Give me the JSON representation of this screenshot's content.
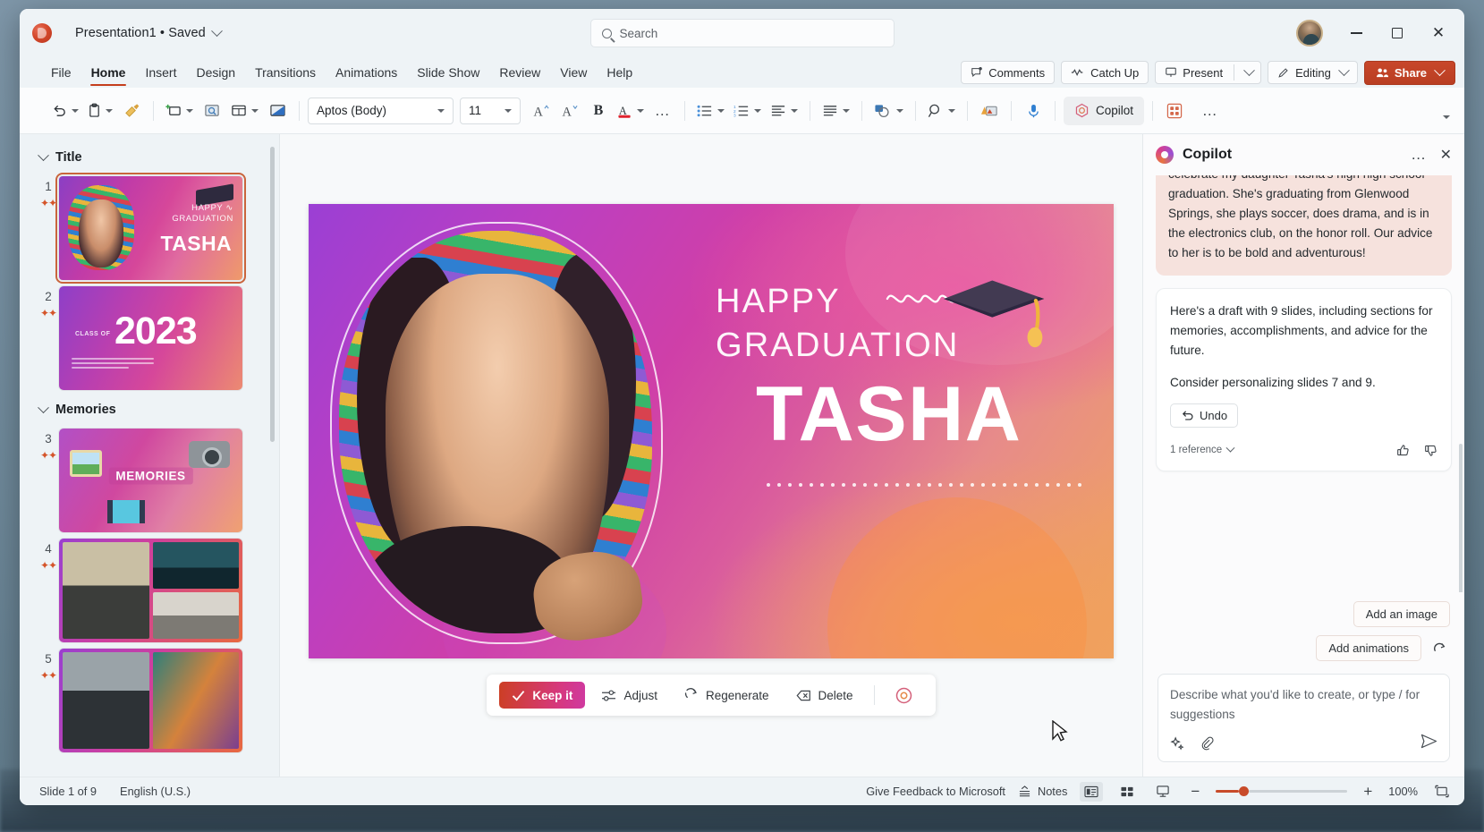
{
  "titlebar": {
    "app_icon": "powerpoint-logo",
    "document_name": "Presentation1 • Saved",
    "search_placeholder": "Search",
    "avatar": "user-avatar",
    "minimize": "–",
    "maximize": "▢",
    "close": "✕"
  },
  "ribbon": {
    "tabs": [
      {
        "label": "File",
        "active": false
      },
      {
        "label": "Home",
        "active": true
      },
      {
        "label": "Insert",
        "active": false
      },
      {
        "label": "Design",
        "active": false
      },
      {
        "label": "Transitions",
        "active": false
      },
      {
        "label": "Animations",
        "active": false
      },
      {
        "label": "Slide Show",
        "active": false
      },
      {
        "label": "Review",
        "active": false
      },
      {
        "label": "View",
        "active": false
      },
      {
        "label": "Help",
        "active": false
      }
    ],
    "actions": {
      "comments": "Comments",
      "catch_up": "Catch Up",
      "present": "Present",
      "editing": "Editing",
      "share": "Share"
    }
  },
  "toolbar": {
    "undo": "undo-icon",
    "paste": "paste-icon",
    "format_painter": "format-painter-icon",
    "new_slide": "new-slide-icon",
    "layout_search": "slide-preview-icon",
    "layout": "layout-icon",
    "picture": "picture-icon",
    "font_name": "Aptos (Body)",
    "font_size": "11",
    "grow_font": "A",
    "shrink_font": "A",
    "bold": "B",
    "font_color": "A",
    "more_font": "…",
    "bullets": "bullets-icon",
    "numbering": "numbering-icon",
    "align": "align-icon",
    "paragraph_align": "paragraph-align-icon",
    "shapes": "shapes-icon",
    "find": "find-icon",
    "designer": "designer-icon",
    "dictate": "microphone-icon",
    "copilot": "Copilot",
    "apps": "apps-icon",
    "overflow": "…",
    "collapse": "collapse-ribbon-icon"
  },
  "slide_nav": {
    "sections": [
      {
        "name": "Title",
        "slides": [
          {
            "number": "1",
            "selected": true,
            "title": "HAPPY GRADUATION TASHA",
            "ai": true
          },
          {
            "number": "2",
            "selected": false,
            "title": "CLASS OF 2023",
            "ai": true
          }
        ]
      },
      {
        "name": "Memories",
        "slides": [
          {
            "number": "3",
            "selected": false,
            "title": "MEMORIES",
            "ai": true
          },
          {
            "number": "4",
            "selected": false,
            "title": "Photo collage",
            "ai": true
          },
          {
            "number": "5",
            "selected": false,
            "title": "Photo collage 2",
            "ai": true
          }
        ]
      }
    ]
  },
  "slide": {
    "line1": "HAPPY",
    "line2": "GRADUATION",
    "name": "TASHA",
    "squiggle": "squiggle-decoration",
    "grad_cap": "graduation-cap-emoji",
    "portrait": "student-portrait-photo"
  },
  "action_bar": {
    "keep": "Keep it",
    "adjust": "Adjust",
    "regenerate": "Regenerate",
    "delete": "Delete",
    "copilot_icon": "copilot-icon"
  },
  "copilot": {
    "title": "Copilot",
    "more_options": "…",
    "close": "✕",
    "user_message": "celebrate my daughter Tasha's high high school graduation. She's graduating from Glenwood Springs, she plays soccer, does drama, and is in the electronics club, on the honor roll. Our advice to her is to be bold and adventurous!",
    "ai_paragraph_1": "Here's a draft with 9 slides, including sections for memories, accomplishments, and advice for the future.",
    "ai_paragraph_2": "Consider personalizing slides 7 and 9.",
    "undo_label": "Undo",
    "references": "1 reference",
    "thumbs_up": "thumbs-up-icon",
    "thumbs_down": "thumbs-down-icon",
    "suggestion_1": "Add an image",
    "suggestion_2": "Add animations",
    "refresh": "refresh-suggestions-icon",
    "composer_placeholder": "Describe what you'd like to create, or type / for suggestions",
    "prompt_icon": "sparkle-icon",
    "attach_icon": "attachment-icon",
    "send_icon": "send-icon"
  },
  "statusbar": {
    "slide_count": "Slide 1 of 9",
    "language": "English (U.S.)",
    "feedback": "Give Feedback to Microsoft",
    "notes": "Notes",
    "view_normal": "normal-view-icon",
    "view_sorter": "slide-sorter-icon",
    "view_reading": "reading-view-icon",
    "zoom_out": "−",
    "zoom_in": "+",
    "zoom_level": "100%",
    "fit_slide": "fit-slide-icon"
  },
  "colors": {
    "accent": "#c43e1c",
    "share": "#c8472a",
    "keep_it_start": "#cc3f24",
    "keep_it_end": "#cf39a0",
    "user_bubble": "#f6e2dd"
  }
}
